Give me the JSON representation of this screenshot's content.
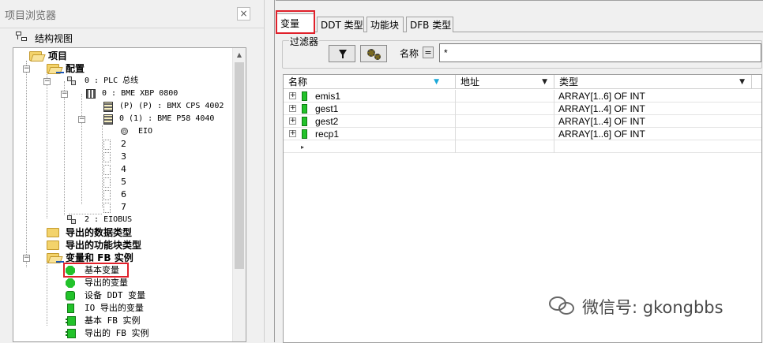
{
  "browser": {
    "title": "项目浏览器",
    "close": "×",
    "view_label": "结构视图"
  },
  "tree": {
    "project": "项目",
    "config": "配置",
    "plc_bus": "0 : PLC 总线",
    "rack": "0 : BME XBP 0800",
    "power": "(P) (P) : BMX CPS 4002",
    "cpu": "0 (1) : BME P58 4040",
    "eio": "EIO",
    "slots": [
      "2",
      "3",
      "4",
      "5",
      "6",
      "7"
    ],
    "eiobus": "2 : EIOBUS",
    "derived_data_types": "导出的数据类型",
    "derived_fb_types": "导出的功能块类型",
    "vars_and_fb": "变量和 FB 实例",
    "elementary_vars": "基本变量",
    "derived_vars": "导出的变量",
    "device_ddt_vars": "设备 DDT 变量",
    "io_derived_vars": "IO 导出的变量",
    "elementary_fb": "基本 FB 实例",
    "derived_fb": "导出的 FB 实例"
  },
  "editor": {
    "tabs": [
      {
        "label": "变量",
        "active": true
      },
      {
        "label": "DDT 类型",
        "active": false
      },
      {
        "label": "功能块",
        "active": false
      },
      {
        "label": "DFB 类型",
        "active": false
      }
    ],
    "filter": {
      "legend": "过滤器",
      "name_label": "名称",
      "eq": "=",
      "value": "*"
    },
    "columns": [
      "名称",
      "地址",
      "类型"
    ],
    "rows": [
      {
        "name": "emis1",
        "address": "",
        "type": "ARRAY[1..6] OF INT"
      },
      {
        "name": "gest1",
        "address": "",
        "type": "ARRAY[1..4] OF INT"
      },
      {
        "name": "gest2",
        "address": "",
        "type": "ARRAY[1..4] OF INT"
      },
      {
        "name": "recp1",
        "address": "",
        "type": "ARRAY[1..6] OF INT"
      }
    ]
  },
  "watermark": "微信号: gkongbbs",
  "colors": {
    "highlight": "#e0202a",
    "variable_green": "#22c22a"
  }
}
